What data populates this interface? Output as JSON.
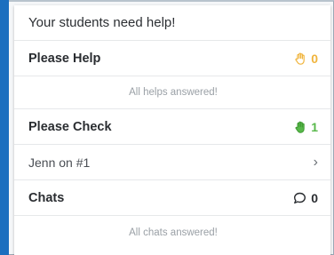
{
  "colors": {
    "accent_bar": "#1c6fbf",
    "orange": "#f0b43c",
    "green": "#58b84a",
    "text": "#2a2d31",
    "muted": "#9aa0a6"
  },
  "panel": {
    "title": "Your students need help!",
    "help": {
      "label": "Please Help",
      "icon": "hand-icon",
      "count": "0",
      "empty_text": "All helps answered!"
    },
    "check": {
      "label": "Please Check",
      "icon": "hand-icon",
      "count": "1",
      "items": [
        {
          "label": "Jenn on #1",
          "icon": "chevron-right-icon"
        }
      ]
    },
    "chats": {
      "label": "Chats",
      "icon": "chat-bubble-icon",
      "count": "0",
      "empty_text": "All chats answered!"
    }
  }
}
